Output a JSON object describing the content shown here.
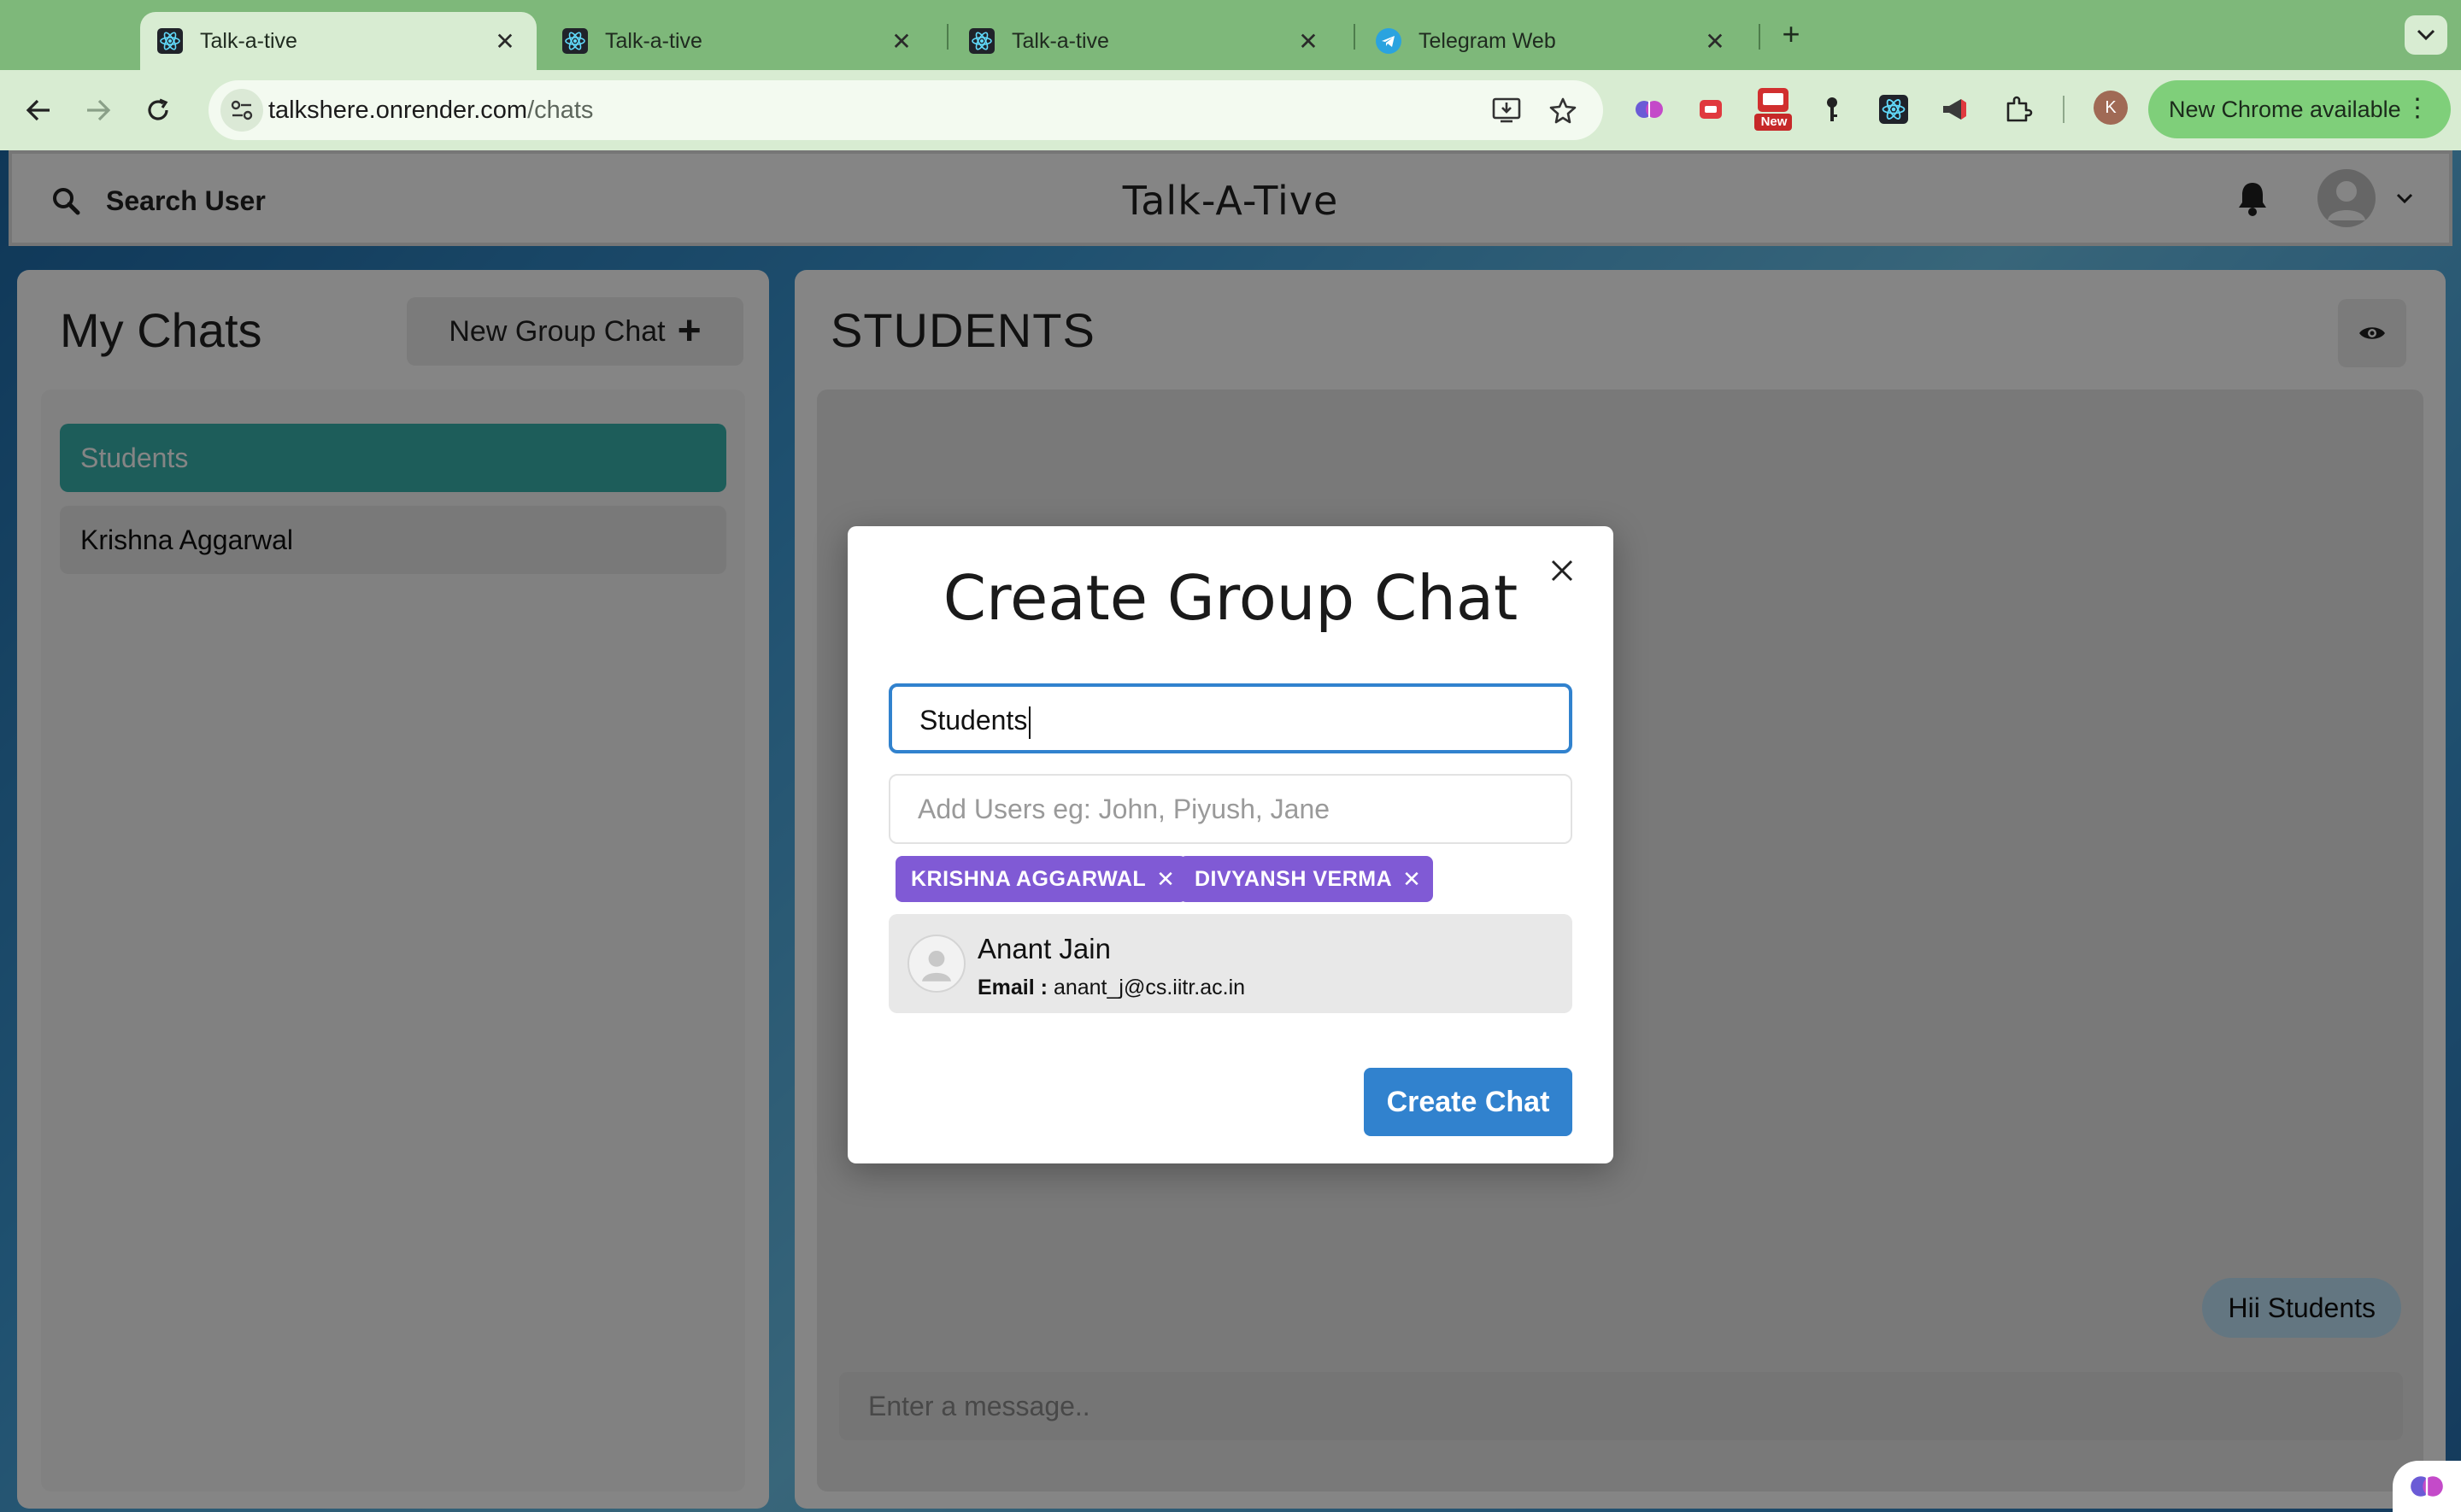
{
  "browser": {
    "tabs": [
      {
        "title": "Talk-a-tive",
        "active": true,
        "icon": "react-icon"
      },
      {
        "title": "Talk-a-tive",
        "active": false,
        "icon": "react-icon"
      },
      {
        "title": "Talk-a-tive",
        "active": false,
        "icon": "react-icon"
      },
      {
        "title": "Telegram Web",
        "active": false,
        "icon": "telegram-icon"
      }
    ],
    "url_host": "talkshere.onrender.com",
    "url_path": "/chats",
    "extension_new_badge": "New",
    "profile_initial": "K",
    "update_label": "New Chrome available"
  },
  "header": {
    "search_label": "Search User",
    "app_title": "Talk-A-Tive"
  },
  "chats": {
    "title": "My Chats",
    "new_group_label": "New Group Chat",
    "new_group_icon": "+",
    "items": [
      {
        "name": "Students",
        "selected": true
      },
      {
        "name": "Krishna Aggarwal",
        "selected": false
      }
    ]
  },
  "chatbox": {
    "title": "STUDENTS",
    "messages": [
      {
        "text": "Hii Students",
        "own": true
      }
    ],
    "input_placeholder": "Enter a message.."
  },
  "modal": {
    "title": "Create Group Chat",
    "chat_name_value": "Students",
    "users_placeholder": "Add Users eg: John, Piyush, Jane",
    "selected_users": [
      "KRISHNA AGGARWAL",
      "DIVYANSH VERMA"
    ],
    "search_results": [
      {
        "name": "Anant Jain",
        "email_label": "Email :",
        "email": "anant_j@cs.iitr.ac.in"
      }
    ],
    "submit_label": "Create Chat"
  },
  "colors": {
    "primary_blue": "#3182ce",
    "tag_purple": "#805ad5",
    "selected_chat_teal": "#38b2ac",
    "message_bubble": "#bee3f8"
  }
}
